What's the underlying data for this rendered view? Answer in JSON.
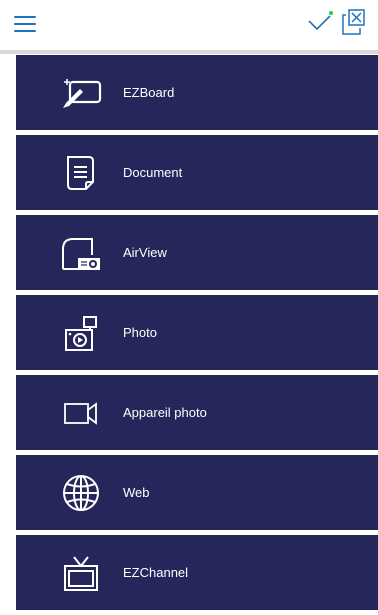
{
  "header": {
    "menu_icon": "hamburger-menu-icon",
    "check_icon": "checkmark-icon",
    "close_icon": "close-window-icon",
    "accent_color": "#1e73be",
    "status_dot_color": "#2ecc40"
  },
  "menu": {
    "background_color": "#25265a",
    "items": [
      {
        "label": "EZBoard",
        "icon": "whiteboard-pen-icon"
      },
      {
        "label": "Document",
        "icon": "document-icon"
      },
      {
        "label": "AirView",
        "icon": "projector-icon"
      },
      {
        "label": "Photo",
        "icon": "photo-icon"
      },
      {
        "label": "Appareil photo",
        "icon": "video-camera-icon"
      },
      {
        "label": "Web",
        "icon": "globe-icon"
      },
      {
        "label": "EZChannel",
        "icon": "tv-icon"
      }
    ]
  }
}
